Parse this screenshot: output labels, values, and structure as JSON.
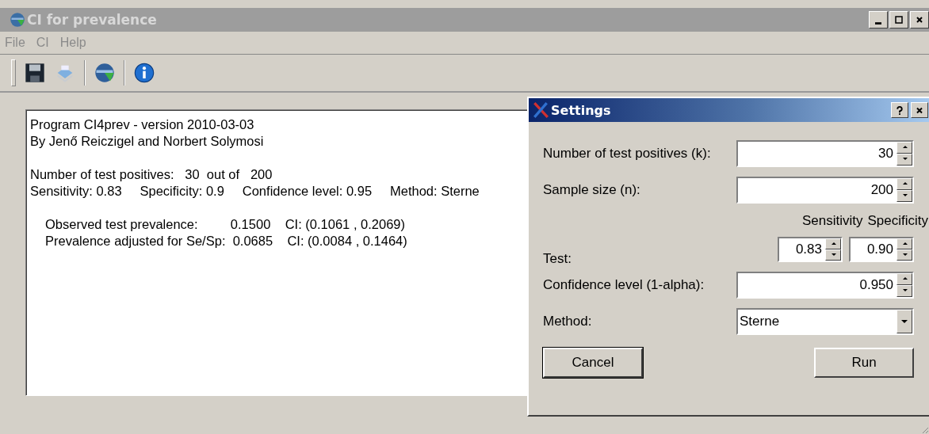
{
  "window": {
    "title": "CI for prevalence"
  },
  "menu": [
    {
      "label": "File",
      "disabled": true
    },
    {
      "label": "CI",
      "disabled": true
    },
    {
      "label": "Help",
      "disabled": true
    }
  ],
  "toolbar": [
    {
      "kind": "save"
    },
    {
      "kind": "print"
    },
    {
      "kind": "separator"
    },
    {
      "kind": "globe"
    },
    {
      "kind": "separator"
    },
    {
      "kind": "info"
    }
  ],
  "output": {
    "paragraphs": [
      {
        "indent": false,
        "lines": [
          "Program CI4prev - version 2010-03-03",
          "By Jenő Reiczigel and Norbert Solymosi"
        ]
      },
      {
        "indent": false,
        "lines": [
          "Number of test positives:   30  out of   200",
          "Sensitivity: 0.83     Specificity: 0.9     Confidence level: 0.95     Method: Sterne"
        ]
      },
      {
        "indent": true,
        "lines": [
          "Observed test prevalence:         0.1500    CI: (0.1061 , 0.2069)",
          "Prevalence adjusted for Se/Sp:  0.0685    CI: (0.0084 , 0.1464)"
        ]
      }
    ]
  },
  "settings": {
    "title": "Settings",
    "fields": [
      {
        "kind": "spin",
        "label": "Number of test positives (k):",
        "value": "30"
      },
      {
        "kind": "spin",
        "label": "Sample size (n):",
        "value": "200"
      },
      {
        "kind": "test",
        "label": "Test:",
        "columns": [
          {
            "heading": "Sensitivity",
            "value": "0.83"
          },
          {
            "heading": "Specificity",
            "value": "0.90"
          }
        ]
      },
      {
        "kind": "spin",
        "label": "Confidence level (1-alpha):",
        "value": "0.950"
      },
      {
        "kind": "combo",
        "label": "Method:",
        "value": "Sterne"
      }
    ],
    "buttons": [
      {
        "label": "Cancel",
        "default": true
      },
      {
        "label": "Run",
        "default": false
      }
    ]
  }
}
